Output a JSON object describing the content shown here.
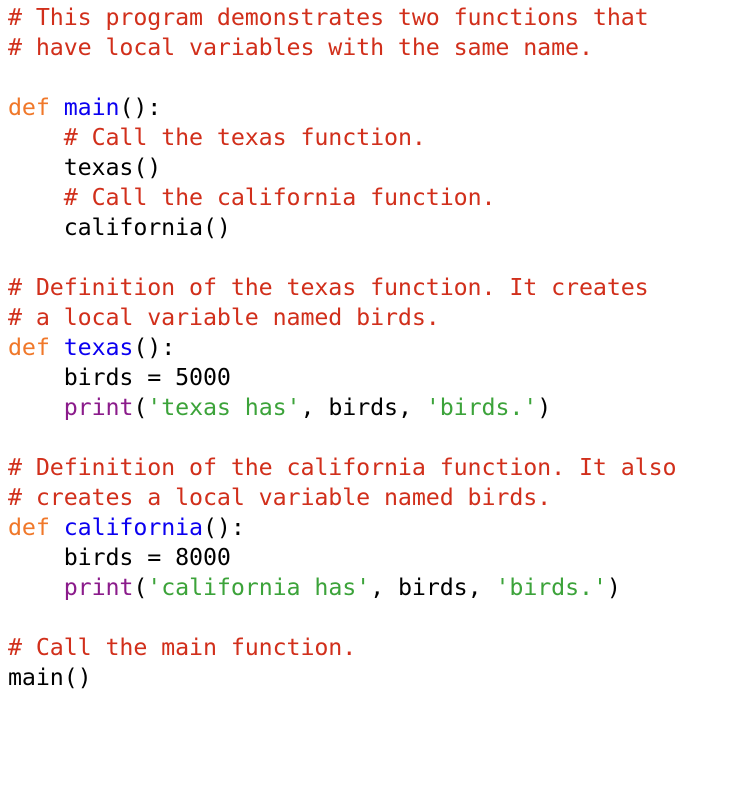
{
  "colors": {
    "comment": "#d12f1b",
    "keyword": "#f0782a",
    "function_name": "#0b00f0",
    "builtin": "#8b1b8b",
    "string": "#3ca33a",
    "plain": "#000000"
  },
  "lines": [
    [
      {
        "t": "comment",
        "v": "# This program demonstrates two functions that"
      }
    ],
    [
      {
        "t": "comment",
        "v": "# have local variables with the same name."
      }
    ],
    [],
    [
      {
        "t": "keyword",
        "v": "def"
      },
      {
        "t": "plain",
        "v": " "
      },
      {
        "t": "name",
        "v": "main"
      },
      {
        "t": "plain",
        "v": "():"
      }
    ],
    [
      {
        "t": "plain",
        "v": "    "
      },
      {
        "t": "comment",
        "v": "# Call the texas function."
      }
    ],
    [
      {
        "t": "plain",
        "v": "    texas()"
      }
    ],
    [
      {
        "t": "plain",
        "v": "    "
      },
      {
        "t": "comment",
        "v": "# Call the california function."
      }
    ],
    [
      {
        "t": "plain",
        "v": "    california()"
      }
    ],
    [],
    [
      {
        "t": "comment",
        "v": "# Definition of the texas function. It creates"
      }
    ],
    [
      {
        "t": "comment",
        "v": "# a local variable named birds."
      }
    ],
    [
      {
        "t": "keyword",
        "v": "def"
      },
      {
        "t": "plain",
        "v": " "
      },
      {
        "t": "name",
        "v": "texas"
      },
      {
        "t": "plain",
        "v": "():"
      }
    ],
    [
      {
        "t": "plain",
        "v": "    birds = 5000"
      }
    ],
    [
      {
        "t": "plain",
        "v": "    "
      },
      {
        "t": "builtin",
        "v": "print"
      },
      {
        "t": "plain",
        "v": "("
      },
      {
        "t": "string",
        "v": "'texas has'"
      },
      {
        "t": "plain",
        "v": ", birds, "
      },
      {
        "t": "string",
        "v": "'birds.'"
      },
      {
        "t": "plain",
        "v": ")"
      }
    ],
    [],
    [
      {
        "t": "comment",
        "v": "# Definition of the california function. It also"
      }
    ],
    [
      {
        "t": "comment",
        "v": "# creates a local variable named birds."
      }
    ],
    [
      {
        "t": "keyword",
        "v": "def"
      },
      {
        "t": "plain",
        "v": " "
      },
      {
        "t": "name",
        "v": "california"
      },
      {
        "t": "plain",
        "v": "():"
      }
    ],
    [
      {
        "t": "plain",
        "v": "    birds = 8000"
      }
    ],
    [
      {
        "t": "plain",
        "v": "    "
      },
      {
        "t": "builtin",
        "v": "print"
      },
      {
        "t": "plain",
        "v": "("
      },
      {
        "t": "string",
        "v": "'california has'"
      },
      {
        "t": "plain",
        "v": ", birds, "
      },
      {
        "t": "string",
        "v": "'birds.'"
      },
      {
        "t": "plain",
        "v": ")"
      }
    ],
    [],
    [
      {
        "t": "comment",
        "v": "# Call the main function."
      }
    ],
    [
      {
        "t": "plain",
        "v": "main()"
      }
    ]
  ]
}
